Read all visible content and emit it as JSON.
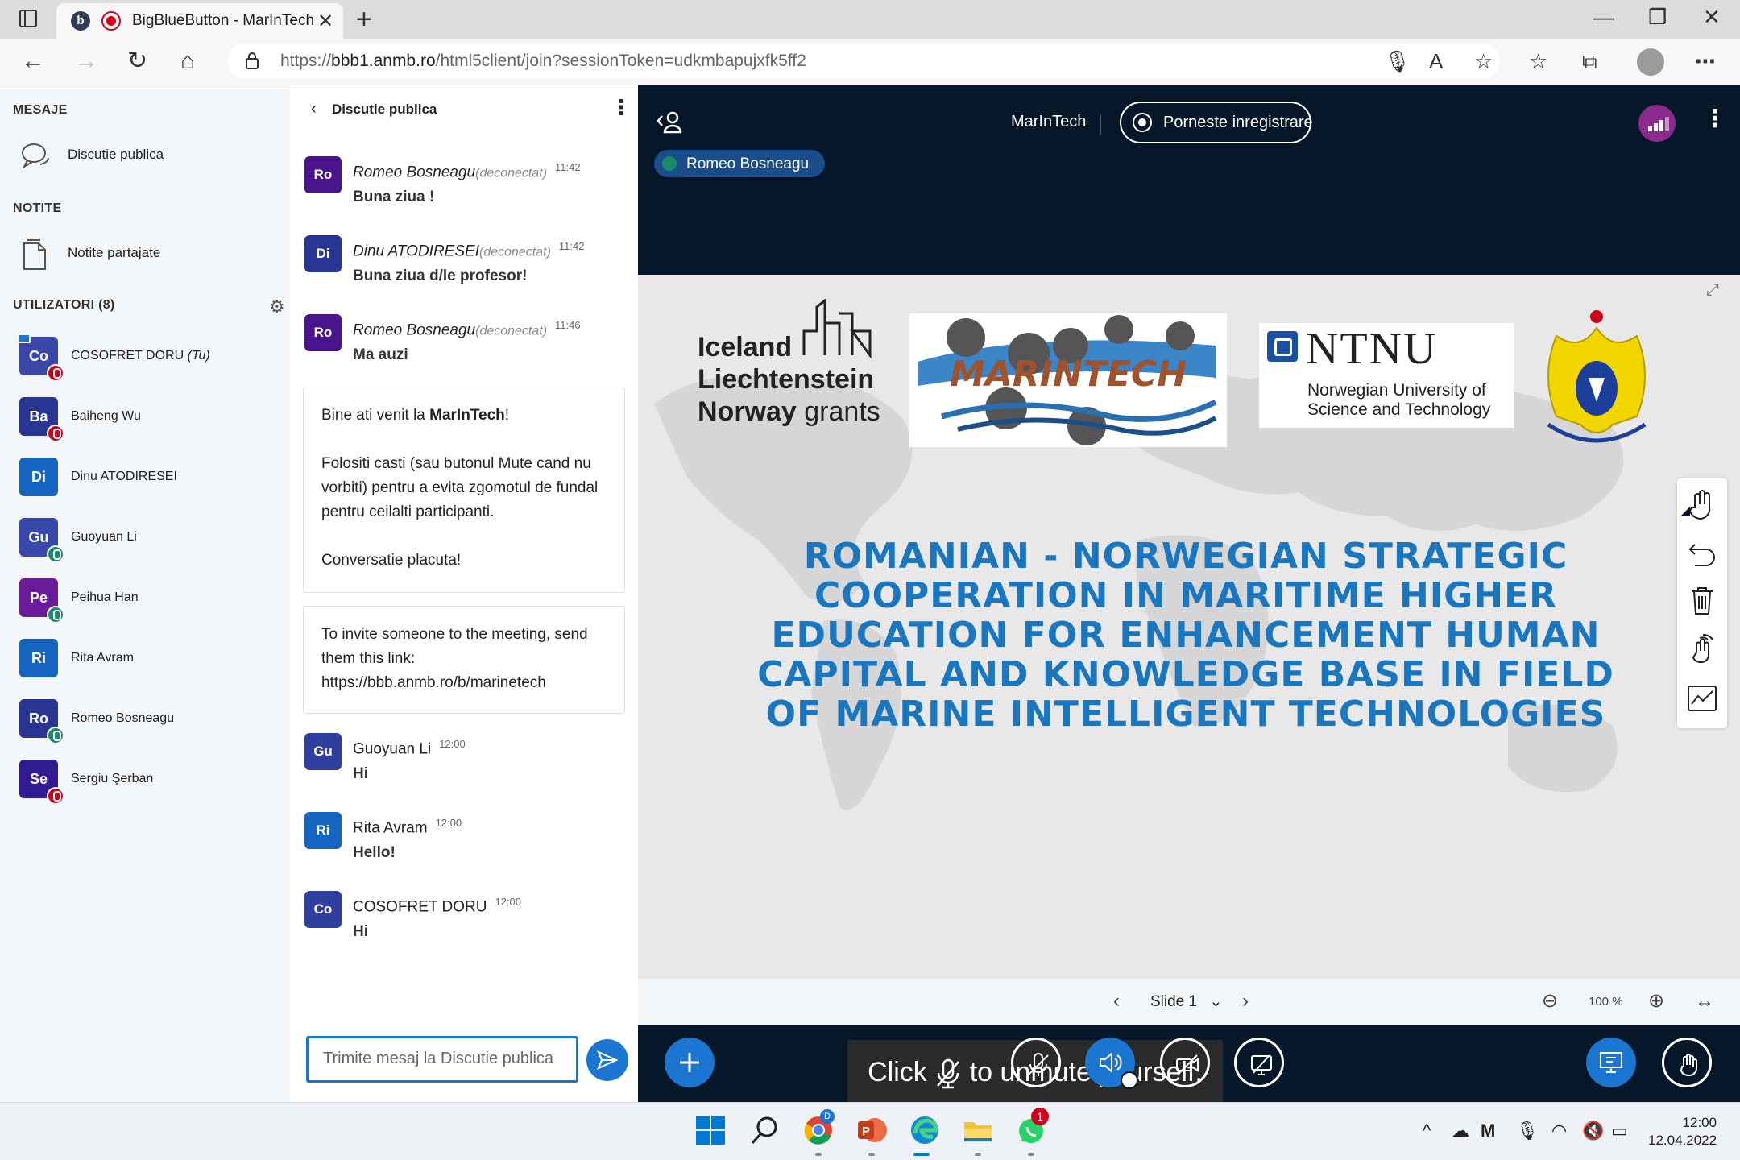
{
  "browser": {
    "tab_title": "BigBlueButton - MarInTech",
    "url_prefix": "https://",
    "url_host": "bbb1.anmb.ro",
    "url_path": "/html5client/join?sessionToken=udkmbapujxfk5ff2"
  },
  "sidebar": {
    "messages_title": "MESAJE",
    "public_chat_label": "Discutie publica",
    "notes_title": "NOTITE",
    "shared_notes_label": "Notite partajate",
    "users_title": "UTILIZATORI (8)",
    "users": [
      {
        "initials": "Co",
        "name": "COSOFRET DORU",
        "you": "(Tu)",
        "color": "#3a46a8",
        "status": "mute"
      },
      {
        "initials": "Ba",
        "name": "Baiheng Wu",
        "color": "#283593",
        "status": "mute"
      },
      {
        "initials": "Di",
        "name": "Dinu ATODIRESEI",
        "color": "#1565c0",
        "status": "none"
      },
      {
        "initials": "Gu",
        "name": "Guoyuan Li",
        "color": "#3949ab",
        "status": "mic"
      },
      {
        "initials": "Pe",
        "name": "Peihua Han",
        "color": "#6a1b9a",
        "status": "head"
      },
      {
        "initials": "Ri",
        "name": "Rita Avram",
        "color": "#1565c0",
        "status": "none"
      },
      {
        "initials": "Ro",
        "name": "Romeo Bosneagu",
        "color": "#283593",
        "status": "mic"
      },
      {
        "initials": "Se",
        "name": "Sergiu Şerban",
        "color": "#311b92",
        "status": "mute"
      }
    ]
  },
  "chat": {
    "title": "Discutie publica",
    "messages": [
      {
        "initials": "Ro",
        "color": "#4a148c",
        "author": "Romeo Bosneagu",
        "status": "(deconectat)",
        "time": "11:42",
        "text": "Buna ziua !"
      },
      {
        "initials": "Di",
        "color": "#283593",
        "author": "Dinu ATODIRESEI",
        "status": "(deconectat)",
        "time": "11:42",
        "text": "Buna ziua d/le profesor!"
      },
      {
        "initials": "Ro",
        "color": "#4a148c",
        "author": "Romeo Bosneagu",
        "status": "(deconectat)",
        "time": "11:46",
        "text": "Ma auzi"
      },
      {
        "initials": "Gu",
        "color": "#303f9f",
        "author": "Guoyuan Li",
        "status": "",
        "time": "12:00",
        "text": "Hi"
      },
      {
        "initials": "Ri",
        "color": "#1565c0",
        "author": "Rita Avram",
        "status": "",
        "time": "12:00",
        "text": "Hello!"
      },
      {
        "initials": "Co",
        "color": "#303f9f",
        "author": "COSOFRET DORU",
        "status": "",
        "time": "12:00",
        "text": "Hi"
      }
    ],
    "welcome": {
      "line1_pre": "Bine ati venit la ",
      "line1_bold": "MarInTech",
      "line1_post": "!",
      "line2": "Folositi casti (sau butonul Mute cand nu vorbiti) pentru a evita zgomotul de fundal pentru ceilalti participanti.",
      "line3": "Conversatie placuta!"
    },
    "invite": {
      "text": "To invite someone to the meeting, send them this link:",
      "link": "https://bbb.anmb.ro/b/marinetech"
    },
    "input_placeholder": "Trimite mesaj la Discutie publica"
  },
  "meeting": {
    "title": "MarInTech",
    "record_label": "Porneste inregistrare",
    "talker": "Romeo Bosneagu",
    "slide_label": "Slide 1",
    "zoom": "100 %",
    "unmute_pre": "Click",
    "unmute_post": "to unmute yourself."
  },
  "slide": {
    "grants_line1": "Iceland",
    "grants_line2": "Liechtenstein",
    "grants_line3a": "Norway",
    "grants_line3b": " grants",
    "marintech_logo_text": "MARINTECH",
    "ntnu_name": "NTNU",
    "ntnu_sub1": "Norwegian University of",
    "ntnu_sub2": "Science and Technology",
    "title": "ROMANIAN - NORWEGIAN STRATEGIC COOPERATION IN MARITIME HIGHER EDUCATION FOR ENHANCEMENT HUMAN CAPITAL AND KNOWLEDGE BASE IN FIELD OF MARINE INTELLIGENT TECHNOLOGIES"
  },
  "taskbar": {
    "time": "12:00",
    "date": "12.04.2022",
    "whatsapp_badge": "1",
    "chrome_badge": "D"
  }
}
